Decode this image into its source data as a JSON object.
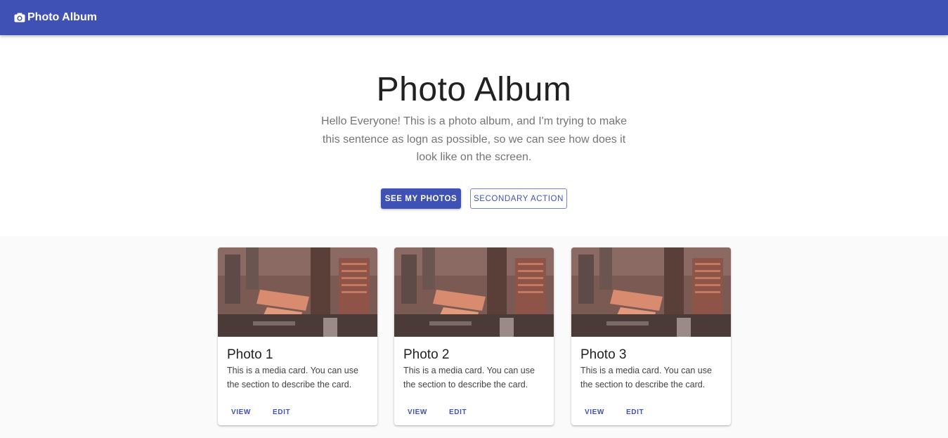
{
  "appbar": {
    "icon": "camera-icon",
    "brand": "Photo Album",
    "color": "#3f51b5"
  },
  "hero": {
    "title": "Photo Album",
    "lead": "Hello Everyone! This is a photo album, and I'm trying to make this sentence as logn as possible, so we can see how does it look like on the screen.",
    "primary_button": "SEE MY PHOTOS",
    "secondary_button": "SECONDARY ACTION"
  },
  "cards": [
    {
      "title": "Photo 1",
      "description": "This is a media card. You can use the section to describe the card.",
      "view_label": "VIEW",
      "edit_label": "EDIT"
    },
    {
      "title": "Photo 2",
      "description": "This is a media card. You can use the section to describe the card.",
      "view_label": "VIEW",
      "edit_label": "EDIT"
    },
    {
      "title": "Photo 3",
      "description": "This is a media card. You can use the section to describe the card.",
      "view_label": "VIEW",
      "edit_label": "EDIT"
    }
  ]
}
